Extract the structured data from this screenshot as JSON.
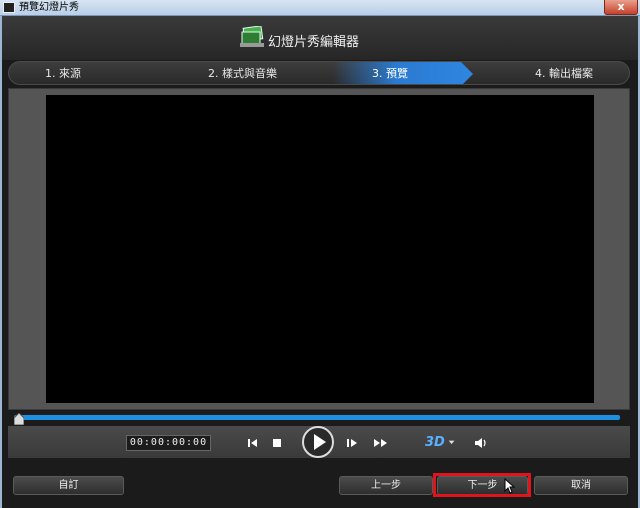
{
  "window": {
    "title": "預覽幻燈片秀",
    "close_label": "x"
  },
  "header": {
    "title": "幻燈片秀編輯器"
  },
  "steps": [
    {
      "label": "1. 來源"
    },
    {
      "label": "2. 樣式與音樂"
    },
    {
      "label": "3. 預覽",
      "active": true
    },
    {
      "label": "4. 輸出檔案"
    }
  ],
  "player": {
    "timecode": "00:00:00:00",
    "progress": 0,
    "three_d_label": "3D",
    "accent_color": "#1f8fe0"
  },
  "footer": {
    "custom_label": "自訂",
    "prev_label": "上一步",
    "next_label": "下一步",
    "cancel_label": "取消"
  }
}
